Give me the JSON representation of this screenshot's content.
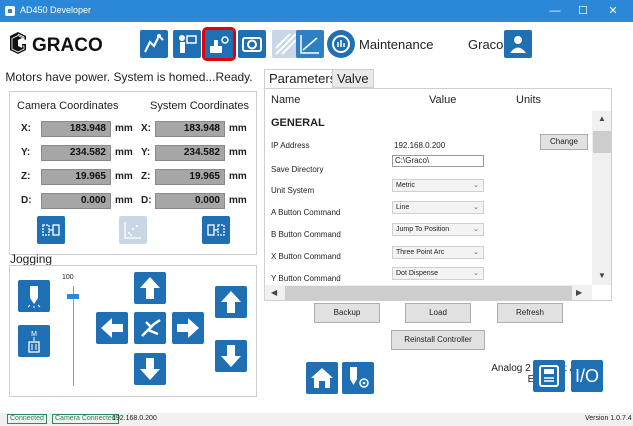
{
  "window": {
    "title": "AD450 Developer",
    "minimize": "—",
    "maximize": "☐",
    "close": "✕"
  },
  "toolbar": {
    "brand": "GRACO",
    "mode_label": "Maintenance",
    "user_label": "Graco",
    "icons": [
      "system-status-icon",
      "workstation-icon",
      "maintenance-icon",
      "camera-icon",
      "dispense-path-icon",
      "graph-icon",
      "vision-icon",
      "user-icon"
    ],
    "selected": "maintenance-icon"
  },
  "status_message": "Motors have power. System is homed...Ready.",
  "coordinates": {
    "camera_header": "Camera Coordinates",
    "system_header": "System Coordinates",
    "rows": [
      {
        "axis": "X:",
        "camera": "183.948",
        "system": "183.948",
        "unit": "mm"
      },
      {
        "axis": "Y:",
        "camera": "234.582",
        "system": "234.582",
        "unit": "mm"
      },
      {
        "axis": "Z:",
        "camera": "19.965",
        "system": "19.965",
        "unit": "mm"
      },
      {
        "axis": "D:",
        "camera": "0.000",
        "system": "0.000",
        "unit": "mm"
      }
    ]
  },
  "jogging": {
    "title": "Jogging",
    "speed": "100"
  },
  "tabs": [
    "Parameters",
    "Valve"
  ],
  "parameters": {
    "headers": {
      "name": "Name",
      "value": "Value",
      "units": "Units"
    },
    "group": "GENERAL",
    "rows": [
      {
        "name": "IP Address",
        "value": "192.168.0.200",
        "kind": "text"
      },
      {
        "name": "Save Directory",
        "value": "C:\\Graco\\",
        "kind": "input"
      },
      {
        "name": "Unit System",
        "value": "Metric",
        "kind": "select"
      },
      {
        "name": "A Button Command",
        "value": "Line",
        "kind": "select"
      },
      {
        "name": "B Button Command",
        "value": "Jump To Position",
        "kind": "select"
      },
      {
        "name": "X Button Command",
        "value": "Three Point Arc",
        "kind": "select"
      },
      {
        "name": "Y Button Command",
        "value": "Dot Dispense",
        "kind": "select"
      }
    ],
    "change_label": "Change"
  },
  "actions": {
    "backup": "Backup",
    "load": "Load",
    "refresh": "Refresh",
    "reinstall": "Reinstall Controller"
  },
  "analog_status": "Analog 2 Enable: Analog Enabled",
  "io_label": "I/O",
  "statusbar": {
    "connected": "Connected",
    "camera": "Camera Connected",
    "ip": "192.168.0.200",
    "version": "Version 1.0.7.4"
  },
  "colors": {
    "accent": "#1f6fb5",
    "titlebar": "#2b88d8",
    "selected_outline": "#e00000",
    "value_box": "#a6a6a6"
  }
}
